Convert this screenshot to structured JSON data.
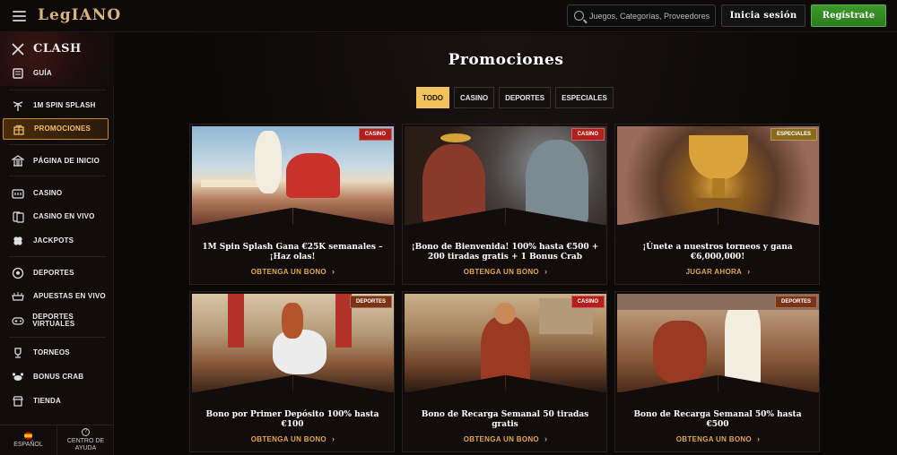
{
  "header": {
    "logo": "LegIANO",
    "search_placeholder": "Juegos, Categorías, Proveedores",
    "login_label": "Inicia sesión",
    "register_label": "Regístrate"
  },
  "sidebar": {
    "items": [
      {
        "label": "CLASH",
        "icon": "crossed-swords-icon"
      },
      {
        "label": "GUÍA",
        "icon": "scroll-icon"
      },
      {
        "label": "1M SPIN SPLASH",
        "icon": "palm-tree-icon"
      },
      {
        "label": "PROMOCIONES",
        "icon": "gift-icon"
      },
      {
        "label": "PÁGINA DE INICIO",
        "icon": "temple-icon"
      },
      {
        "label": "CASINO",
        "icon": "slot-machine-icon"
      },
      {
        "label": "CASINO EN VIVO",
        "icon": "cards-icon"
      },
      {
        "label": "JACKPOTS",
        "icon": "clover-icon"
      },
      {
        "label": "DEPORTES",
        "icon": "soccer-ball-icon"
      },
      {
        "label": "APUESTAS EN VIVO",
        "icon": "stadium-icon"
      },
      {
        "label": "DEPORTES VIRTUALES",
        "icon": "gamepad-icon"
      },
      {
        "label": "TORNEOS",
        "icon": "trophy-icon"
      },
      {
        "label": "BONUS CRAB",
        "icon": "crab-icon"
      },
      {
        "label": "TIENDA",
        "icon": "shop-icon"
      }
    ],
    "active_item": "PROMOCIONES",
    "language": "ESPAÑOL",
    "help": "CENTRO DE AYUDA"
  },
  "main": {
    "title": "Promociones",
    "tabs": [
      "TODO",
      "CASINO",
      "DEPORTES",
      "ESPECIALES"
    ],
    "active_tab": "TODO",
    "cards": [
      {
        "badge": "CASINO",
        "title": "1M Spin Splash Gana €25K semanales – ¡Haz olas!",
        "cta": "OBTENGA UN BONO"
      },
      {
        "badge": "CASINO",
        "title": "¡Bono de Bienvenida! 100% hasta €500 + 200 tiradas gratis + 1 Bonus Crab",
        "cta": "OBTENGA UN BONO"
      },
      {
        "badge": "ESPECIALES",
        "title": "¡Únete a nuestros torneos y gana €6,000,000!",
        "cta": "JUGAR AHORA"
      },
      {
        "badge": "DEPORTES",
        "title": "Bono por Primer Depósito 100% hasta €100",
        "cta": "OBTENGA UN BONO"
      },
      {
        "badge": "CASINO",
        "title": "Bono de Recarga Semanal 50 tiradas gratis",
        "cta": "OBTENGA UN BONO"
      },
      {
        "badge": "DEPORTES",
        "title": "Bono de Recarga Semanal 50% hasta €500",
        "cta": "OBTENGA UN BONO"
      }
    ]
  },
  "colors": {
    "accent": "#f2c35a",
    "register_green": "#2f8a22",
    "badge_casino": "#b3201b",
    "badge_deportes": "#7a3415",
    "badge_especiales": "#8a6a1c"
  }
}
